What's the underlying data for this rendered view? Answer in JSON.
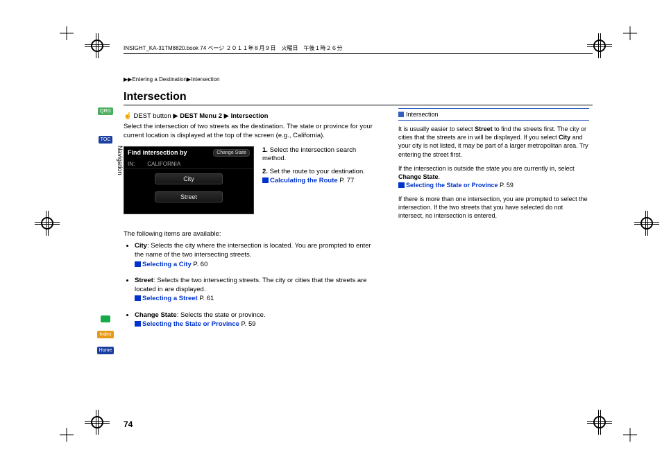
{
  "header_line": "INSIGHT_KA-31TM8820.book  74 ページ  ２０１１年８月９日　火曜日　午後１時２６分",
  "side_tabs": {
    "qrg": "QRG",
    "toc": "TOC",
    "index": "Index",
    "home": "Home"
  },
  "vertical_section": "Navigation",
  "breadcrumb": {
    "a": "Entering a Destination",
    "b": "Intersection"
  },
  "title": "Intersection",
  "nav_path": {
    "prefix": "DEST button",
    "m1": "DEST Menu 2",
    "m2": "Intersection"
  },
  "intro": "Select the intersection of two streets as the destination. The state or province for your current location is displayed at the top of the screen (e.g., California).",
  "screenshot": {
    "title": "Find intersection by",
    "change_state": "Change State",
    "state_label": "IN:",
    "state_value": "CALIFORNIA",
    "btn_city": "City",
    "btn_street": "Street"
  },
  "steps": {
    "s1_num": "1.",
    "s1_text": "Select the intersection search method.",
    "s2_num": "2.",
    "s2_text": "Set the route to your destination.",
    "s2_link": "Calculating the Route",
    "s2_page": "P. 77"
  },
  "items_intro": "The following items are available:",
  "items": {
    "city_label": "City",
    "city_text": ": Selects the city where the intersection is located. You are prompted to enter the name of the two intersecting streets.",
    "city_link": "Selecting a City",
    "city_page": "P. 60",
    "street_label": "Street",
    "street_text": ": Selects the two intersecting streets. The city or cities that the streets are located in are displayed.",
    "street_link": "Selecting a Street",
    "street_page": "P. 61",
    "change_label": "Change State",
    "change_text": ": Selects the state or province.",
    "change_link": "Selecting the State or Province",
    "change_page": "P. 59"
  },
  "sidebar": {
    "heading": "Intersection",
    "p1a": "It is usually easier to select ",
    "p1b": "Street",
    "p1c": " to find the streets first. The city or cities that the streets are in will be displayed. If you select ",
    "p1d": "City",
    "p1e": " and your city is not listed, it may be part of a larger metropolitan area. Try entering the street first.",
    "p2a": "If the intersection is outside the state you are currently in, select ",
    "p2b": "Change State",
    "p2c": ".",
    "p2_link": "Selecting the State or Province",
    "p2_page": "P. 59",
    "p3": "If there is more than one intersection, you are prompted to select the intersection. If the two streets that you have selected do not intersect, no intersection is entered."
  },
  "page_number": "74"
}
